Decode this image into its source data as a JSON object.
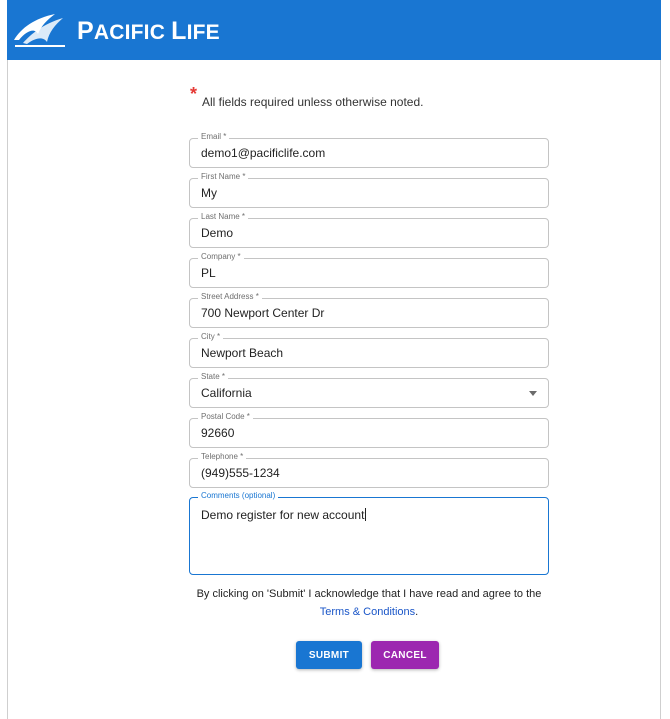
{
  "header": {
    "brand_first": "P",
    "brand_rest1": "ACIFIC ",
    "brand_L": "L",
    "brand_rest2": "IFE",
    "color": "#1976d2"
  },
  "form": {
    "required_star": "*",
    "required_note": "All fields required unless otherwise noted.",
    "fields": [
      {
        "label": "Email *",
        "value": "demo1@pacificlife.com"
      },
      {
        "label": "First Name *",
        "value": "My"
      },
      {
        "label": "Last Name *",
        "value": "Demo"
      },
      {
        "label": "Company *",
        "value": "PL"
      },
      {
        "label": "Street Address *",
        "value": "700 Newport Center Dr"
      },
      {
        "label": "City *",
        "value": "Newport Beach"
      },
      {
        "label": "State *",
        "value": "California"
      },
      {
        "label": "Postal Code *",
        "value": "92660"
      },
      {
        "label": "Telephone *",
        "value": "(949)555-1234"
      },
      {
        "label": "Comments (optional)",
        "value": "Demo register for new account"
      }
    ],
    "ack_text": "By clicking on 'Submit' I acknowledge that I have read and agree to the ",
    "terms_link": "Terms & Conditions",
    "ack_end": "."
  },
  "buttons": {
    "submit": "SUBMIT",
    "cancel": "CANCEL",
    "submit_color": "#1976d2",
    "cancel_color": "#9c27b0"
  }
}
